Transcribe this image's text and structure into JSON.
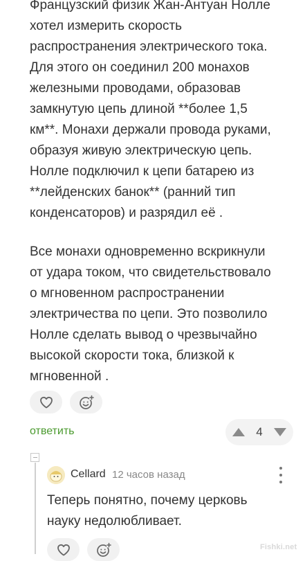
{
  "article": {
    "paragraph1": "Французский физик Жан-Антуан Нолле\nхотел измерить скорость\nраспространения электрического тока.\nДля этого он соединил 200 монахов\nжелезными проводами, образовав\nзамкнутую цепь длиной **более 1,5\nкм**. Монахи держали провода руками,\nобразуя живую электрическую цепь.\nНолле подключил к цепи батарею из\n**лейденских банок** (ранний тип\nконденсаторов) и разрядил её .",
    "paragraph2": "Все монахи одновременно вскрикнули\nот удара током, что свидетельствовало\nо мгновенном распространении\nэлектричества по цепи. Это позволило\nНолле сделать вывод о чрезвычайно\nвысокой скорости тока, близкой к\nмгновенной ."
  },
  "actions": {
    "reply_label": "ответить",
    "vote_count": "4"
  },
  "comment": {
    "author": "Cellard",
    "time": "12 часов назад",
    "text": "Теперь понятно, почему церковь\nнауку недолюбливает."
  },
  "watermark": "Fishki.net",
  "colors": {
    "reply_green": "#4a9a2e",
    "pill_bg": "#f1f1f1",
    "text": "#333333"
  }
}
